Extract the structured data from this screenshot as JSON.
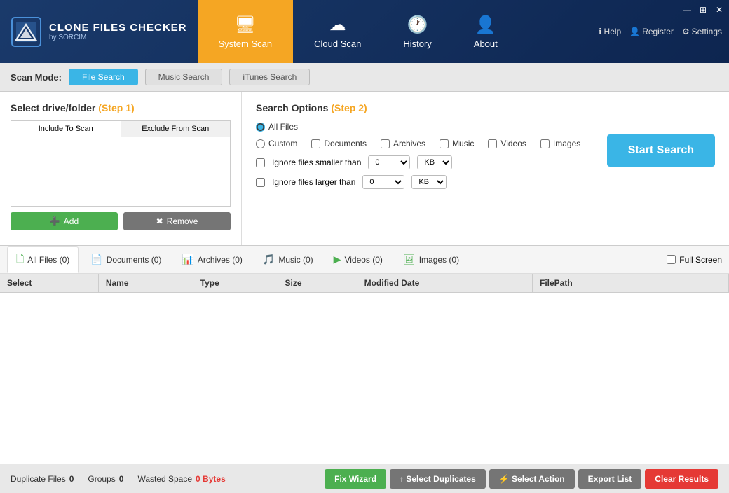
{
  "app": {
    "title": "CLONE FILES CHECKER",
    "subtitle": "by SORCIM"
  },
  "window_controls": {
    "minimize": "—",
    "maximize": "⊞",
    "close": "✕"
  },
  "nav": {
    "tabs": [
      {
        "id": "system-scan",
        "label": "System Scan",
        "icon": "🖥",
        "active": true
      },
      {
        "id": "cloud-scan",
        "label": "Cloud Scan",
        "icon": "☁",
        "active": false
      },
      {
        "id": "history",
        "label": "History",
        "icon": "🕐",
        "active": false
      },
      {
        "id": "about",
        "label": "About",
        "icon": "👤",
        "active": false
      }
    ],
    "help": "Help",
    "register": "Register",
    "settings": "Settings"
  },
  "scan_mode": {
    "label": "Scan Mode:",
    "tabs": [
      {
        "id": "file-search",
        "label": "File Search",
        "active": true
      },
      {
        "id": "music-search",
        "label": "Music Search",
        "active": false
      },
      {
        "id": "itunes-search",
        "label": "iTunes Search",
        "active": false
      }
    ]
  },
  "left_panel": {
    "title": "Select drive/folder",
    "step": "(Step 1)",
    "include_tab": "Include To Scan",
    "exclude_tab": "Exclude From Scan",
    "add_btn": "Add",
    "remove_btn": "Remove"
  },
  "right_panel": {
    "title": "Search Options",
    "step": "(Step 2)",
    "all_files_label": "All Files",
    "custom_label": "Custom",
    "file_types": [
      {
        "id": "documents",
        "label": "Documents"
      },
      {
        "id": "archives",
        "label": "Archives"
      },
      {
        "id": "music",
        "label": "Music"
      },
      {
        "id": "videos",
        "label": "Videos"
      },
      {
        "id": "images",
        "label": "Images"
      }
    ],
    "filter1_label": "Ignore files smaller than",
    "filter2_label": "Ignore files larger than",
    "filter1_value": "0",
    "filter2_value": "0",
    "filter1_unit": "KB",
    "filter2_unit": "KB",
    "start_btn": "Start Search"
  },
  "results_tabs": [
    {
      "id": "all-files",
      "label": "All Files",
      "count": "(0)",
      "icon": "🗋",
      "active": true
    },
    {
      "id": "documents",
      "label": "Documents",
      "count": "(0)",
      "icon": "📄"
    },
    {
      "id": "archives",
      "label": "Archives",
      "count": "(0)",
      "icon": "📊"
    },
    {
      "id": "music",
      "label": "Music",
      "count": "(0)",
      "icon": "🎵"
    },
    {
      "id": "videos",
      "label": "Videos",
      "count": "(0)",
      "icon": "▶"
    },
    {
      "id": "images",
      "label": "Images",
      "count": "(0)",
      "icon": "🖼"
    }
  ],
  "fullscreen_label": "Full Screen",
  "table": {
    "columns": [
      "Select",
      "Name",
      "Type",
      "Size",
      "Modified Date",
      "FilePath"
    ]
  },
  "status_bar": {
    "duplicate_files_label": "Duplicate Files",
    "duplicate_files_value": "0",
    "groups_label": "Groups",
    "groups_value": "0",
    "wasted_space_label": "Wasted Space",
    "wasted_space_value": "0 Bytes"
  },
  "status_buttons": [
    {
      "id": "fix-wizard",
      "label": "Fix Wizard",
      "class": "btn-fix"
    },
    {
      "id": "select-duplicates",
      "label": "↑ Select Duplicates",
      "class": "btn-select-dup"
    },
    {
      "id": "select-action",
      "label": "⚡ Select Action",
      "class": "btn-select-action"
    },
    {
      "id": "export-list",
      "label": "Export List",
      "class": "btn-export"
    },
    {
      "id": "clear-results",
      "label": "Clear Results",
      "class": "btn-clear"
    }
  ]
}
